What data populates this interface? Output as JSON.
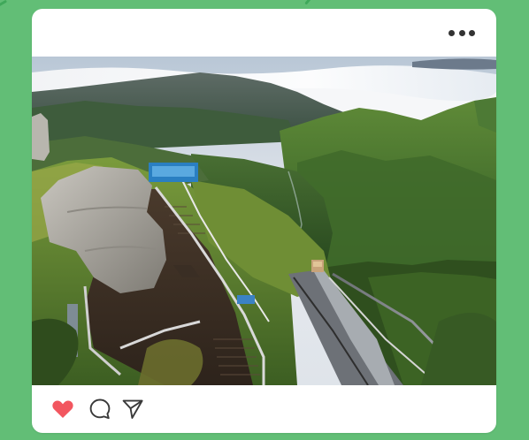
{
  "theme": {
    "background": "#62be76",
    "card": "#ffffff",
    "like_color": "#f2565f",
    "icon_color": "#3a3a3a"
  },
  "post": {
    "menu_icon": "more-horizontal-icon",
    "photo_subject": "mountain-boardwalk-sea-of-clouds",
    "actions": {
      "like_icon": "heart-icon",
      "like_state": "liked",
      "comment_icon": "comment-icon",
      "share_icon": "send-icon"
    }
  }
}
